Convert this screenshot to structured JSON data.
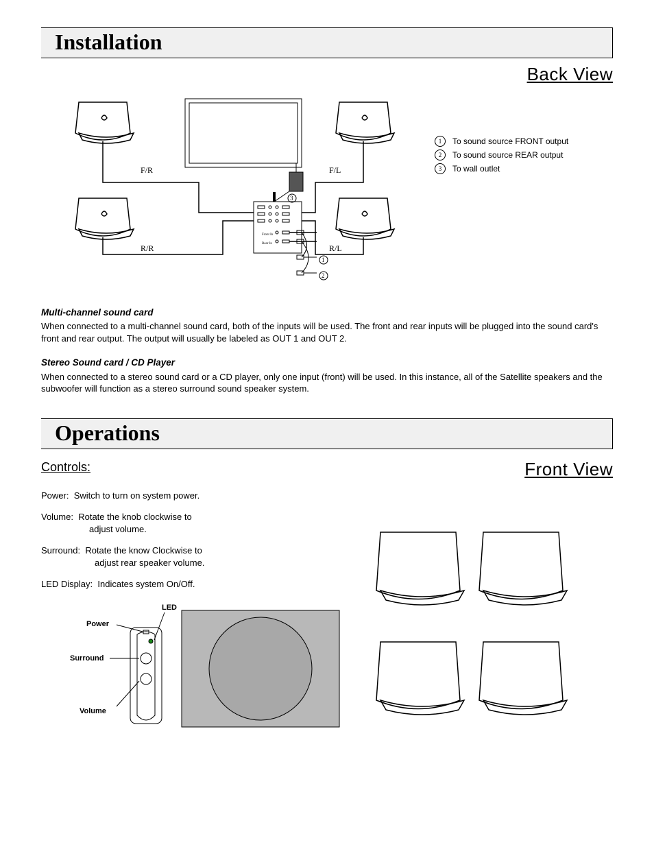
{
  "sections": {
    "installation_title": "Installation",
    "operations_title": "Operations"
  },
  "views": {
    "back": "Back View",
    "front": "Front View"
  },
  "diagram_labels": {
    "fr": "F/R",
    "fl": "F/L",
    "rr": "R/R",
    "rl": "R/L",
    "front_in": "Front In",
    "rear_in": "Rear In",
    "num1": "1",
    "num2": "2",
    "num3": "3"
  },
  "legend": {
    "n1": "To sound source FRONT output",
    "n2": "To sound source REAR output",
    "n3": "To wall outlet"
  },
  "multichannel": {
    "heading": "Multi-channel sound card",
    "body": "When connected to a multi-channel sound card, both of the inputs will be used.  The front and rear inputs will be plugged into the sound card's front and rear output.  The output will usually be labeled as OUT 1 and OUT 2."
  },
  "stereo": {
    "heading": "Stereo Sound card / CD Player",
    "body": "When connected to a stereo sound card or a CD player, only one input (front) will be used.  In this instance, all of the Satellite speakers and the subwoofer will function as a stereo surround sound speaker system."
  },
  "controls": {
    "heading": "Controls:",
    "power_label": "Power:",
    "power_text": "Switch to turn on system power.",
    "volume_label": "Volume:",
    "volume_text1": "Rotate the knob clockwise to",
    "volume_text2": "adjust volume.",
    "surround_label": "Surround:",
    "surround_text1": "Rotate the know Clockwise to",
    "surround_text2": "adjust rear speaker volume.",
    "led_label": "LED Display:",
    "led_text": "Indicates system On/Off."
  },
  "callouts": {
    "led": "LED",
    "power": "Power",
    "surround": "Surround",
    "volume": "Volume"
  }
}
